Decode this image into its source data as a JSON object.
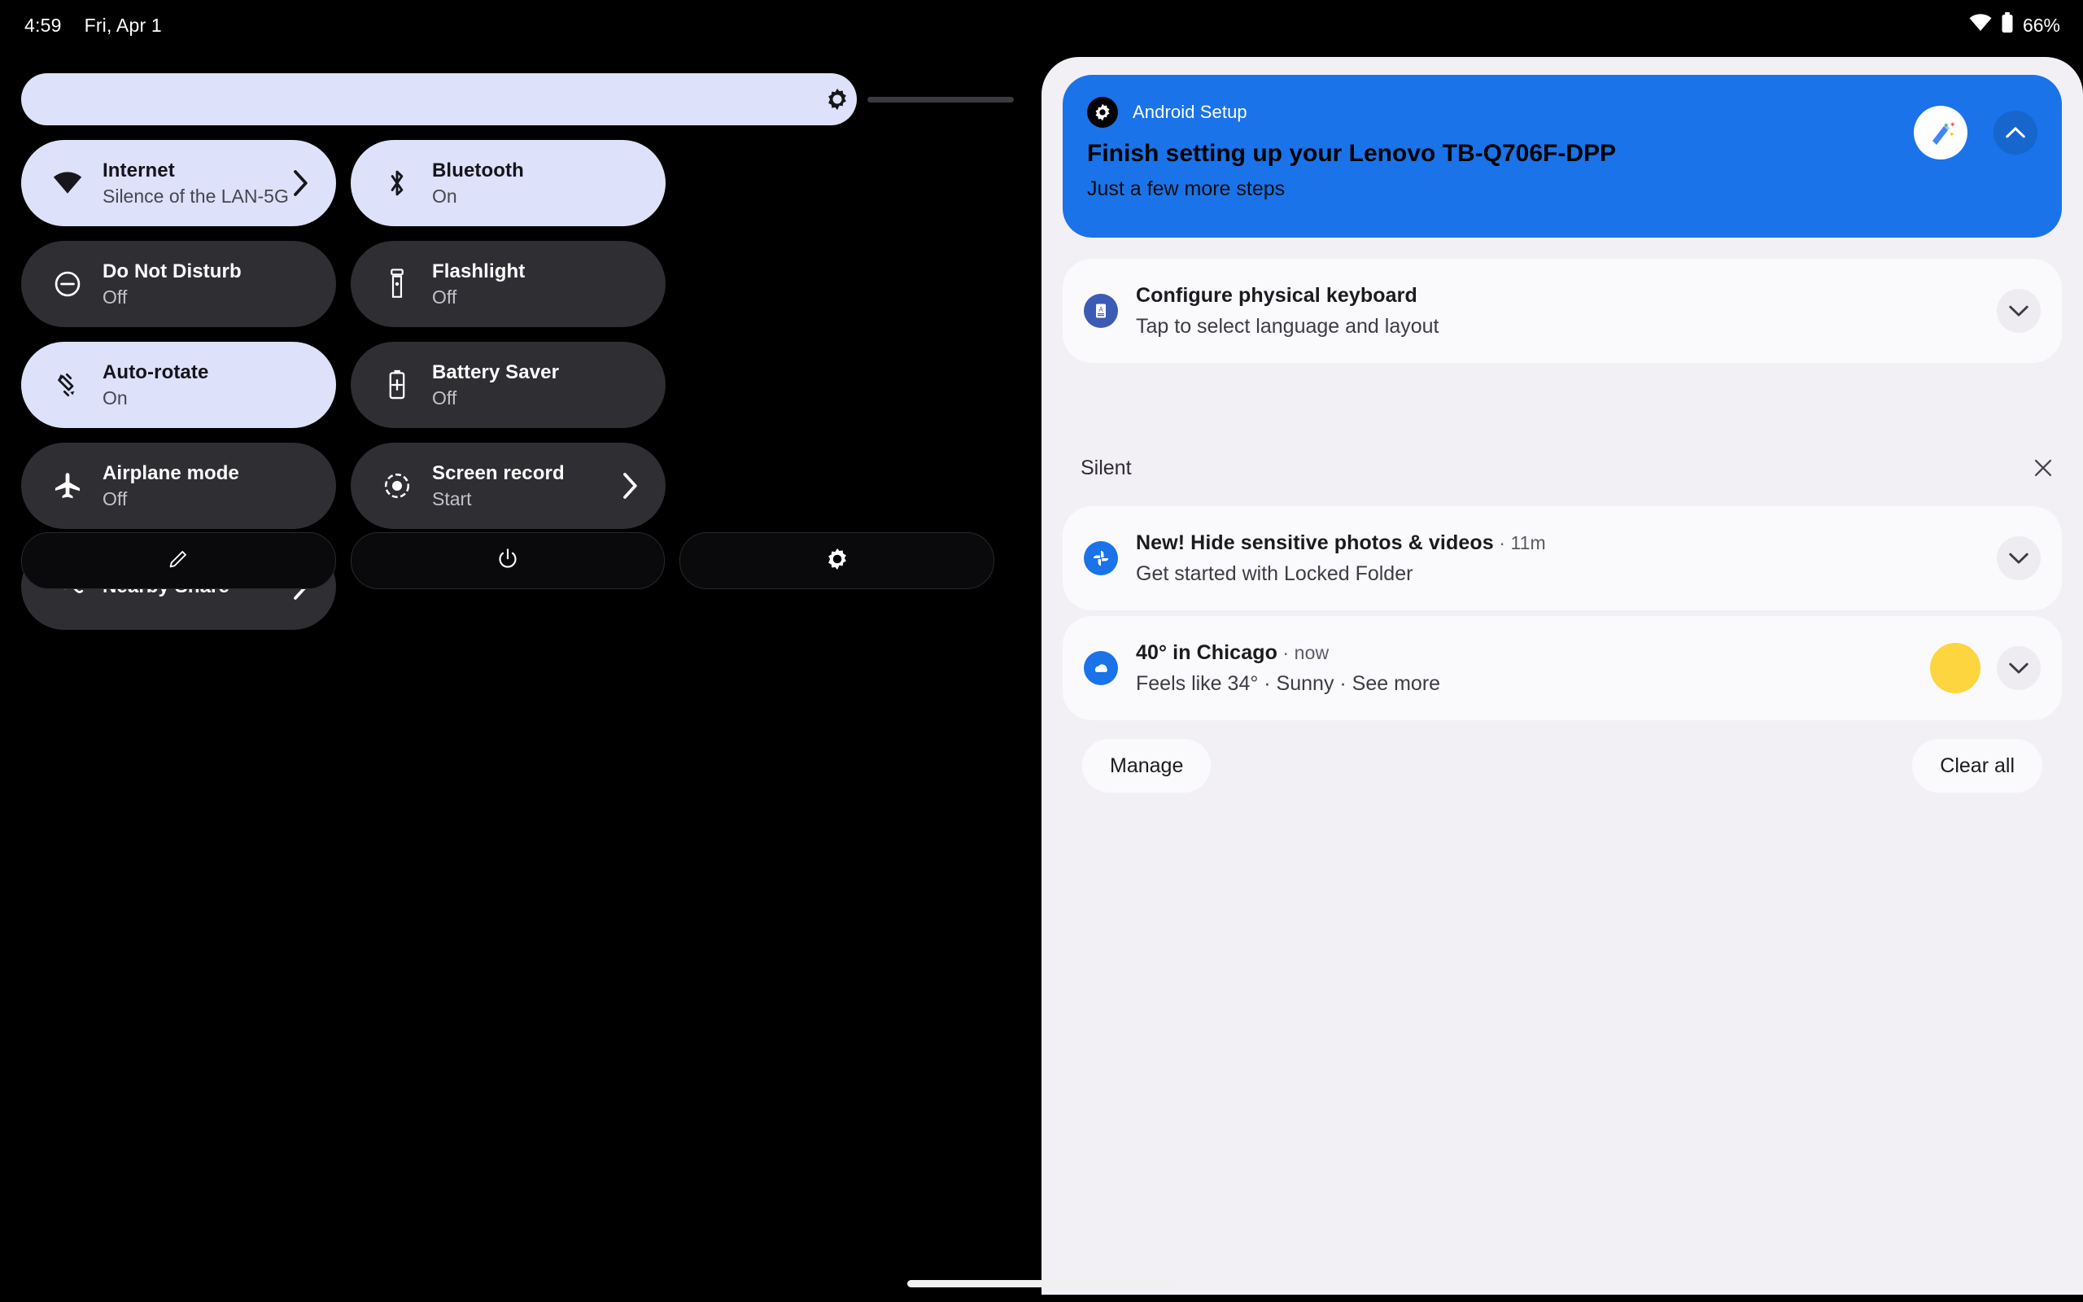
{
  "status_bar": {
    "time": "4:59",
    "date": "Fri, Apr 1",
    "wifi_icon": "wifi-icon",
    "battery_icon": "battery-icon",
    "battery_percent": "66%"
  },
  "quick_settings": {
    "brightness": {
      "name": "brightness-slider",
      "icon": "brightness-icon",
      "value_percent": 86
    },
    "tiles": [
      {
        "title": "Internet",
        "subtitle": "Silence of the LAN-5G",
        "icon": "wifi-icon",
        "state": "on",
        "chevron": true
      },
      {
        "title": "Bluetooth",
        "subtitle": "On",
        "icon": "bluetooth-icon",
        "state": "on",
        "chevron": false
      },
      {
        "title": "Do Not Disturb",
        "subtitle": "Off",
        "icon": "do-not-disturb-icon",
        "state": "off",
        "chevron": false
      },
      {
        "title": "Flashlight",
        "subtitle": "Off",
        "icon": "flashlight-icon",
        "state": "off",
        "chevron": false
      },
      {
        "title": "Auto-rotate",
        "subtitle": "On",
        "icon": "auto-rotate-icon",
        "state": "on",
        "chevron": false
      },
      {
        "title": "Battery Saver",
        "subtitle": "Off",
        "icon": "battery-saver-icon",
        "state": "off",
        "chevron": false
      },
      {
        "title": "Airplane mode",
        "subtitle": "Off",
        "icon": "airplane-icon",
        "state": "off",
        "chevron": false
      },
      {
        "title": "Screen record",
        "subtitle": "Start",
        "icon": "screen-record-icon",
        "state": "off",
        "chevron": true
      },
      {
        "title": "Nearby Share",
        "subtitle": "",
        "icon": "nearby-share-icon",
        "state": "off",
        "chevron": true
      }
    ],
    "actions": [
      {
        "name": "edit-tiles-button",
        "icon": "pencil-icon"
      },
      {
        "name": "power-button",
        "icon": "power-icon"
      },
      {
        "name": "open-settings-button",
        "icon": "gear-icon"
      }
    ]
  },
  "notifications": {
    "setup_card": {
      "app_name": "Android Setup",
      "app_icon": "android-setup-icon",
      "title": "Finish setting up your Lenovo TB-Q706F-DPP",
      "subtitle": "Just a few more steps",
      "avatar_icon": "magic-wand-icon",
      "collapse_icon": "chevron-up-icon",
      "accent_color": "#1a73e8"
    },
    "items": [
      {
        "app_icon": "keyboard-icon",
        "icon_color": "#3b5bb5",
        "title": "Configure physical keyboard",
        "meta": "",
        "subtitle": "Tap to select language and layout",
        "expand_icon": "chevron-down-icon",
        "thumb_color": ""
      },
      {
        "app_icon": "google-photos-icon",
        "icon_color": "#1a73e8",
        "title": "New! Hide sensitive photos & videos",
        "meta": " · 11m",
        "subtitle": "Get started with Locked Folder",
        "expand_icon": "chevron-down-icon",
        "thumb_color": ""
      },
      {
        "app_icon": "weather-icon",
        "icon_color": "#1a73e8",
        "title": "40° in Chicago",
        "meta": " · now",
        "subtitle": "Feels like 34° · Sunny · See more",
        "expand_icon": "chevron-down-icon",
        "thumb_color": "#fcd53f"
      }
    ],
    "silent_section": {
      "label": "Silent",
      "dismiss_icon": "close-icon"
    },
    "footer": {
      "manage_label": "Manage",
      "clear_all_label": "Clear all"
    }
  },
  "nav": {
    "handle": "home-gesture-handle"
  }
}
